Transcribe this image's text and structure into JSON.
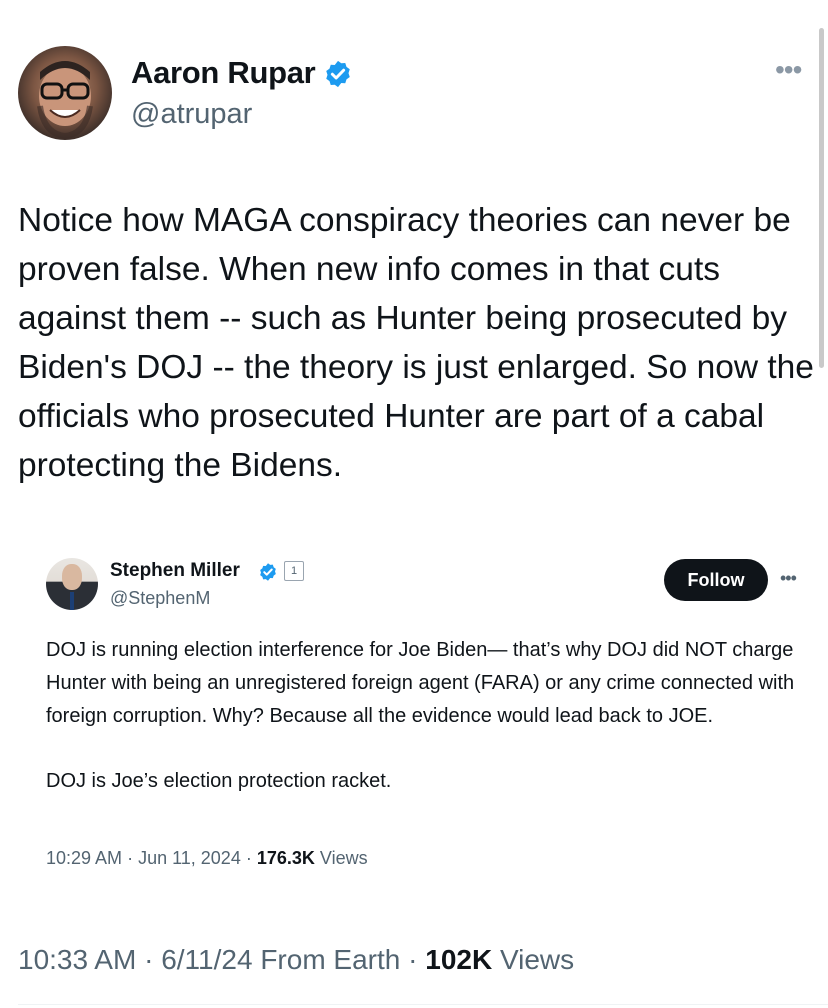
{
  "author": {
    "name": "Aaron Rupar",
    "handle": "@atrupar"
  },
  "more_icon": "•••",
  "tweet": {
    "text": "Notice how MAGA conspiracy theories can never be proven false. When new info comes in that cuts against them -- such as Hunter being prosecuted by Biden's DOJ -- the theory is just enlarged. So now the officials who prosecuted Hunter are part of a cabal protecting the Bidens."
  },
  "quote": {
    "name": "Stephen Miller",
    "handle": "@StephenM",
    "flag_label": "1",
    "follow_label": "Follow",
    "more_icon": "•••",
    "paragraphs": [
      "DOJ is running election interference for Joe Biden— that’s why DOJ did NOT charge Hunter with being an unregistered foreign agent (FARA) or any crime connected with foreign corruption. Why? Because all the evidence would lead back to JOE.",
      "DOJ is Joe’s election protection racket."
    ],
    "meta": {
      "time": "10:29 AM",
      "date": "Jun 11, 2024",
      "views_count": "176.3K",
      "views_label": "Views"
    }
  },
  "meta": {
    "time": "10:33 AM",
    "date": "6/11/24",
    "source": "From Earth",
    "views_count": "102K",
    "views_label": "Views"
  },
  "colors": {
    "verified_blue": "#1d9bf0",
    "secondary_text": "#536471",
    "primary_text": "#0f1419"
  },
  "icons": {
    "verified": "verified-badge-icon",
    "more": "more-horizontal-icon"
  }
}
